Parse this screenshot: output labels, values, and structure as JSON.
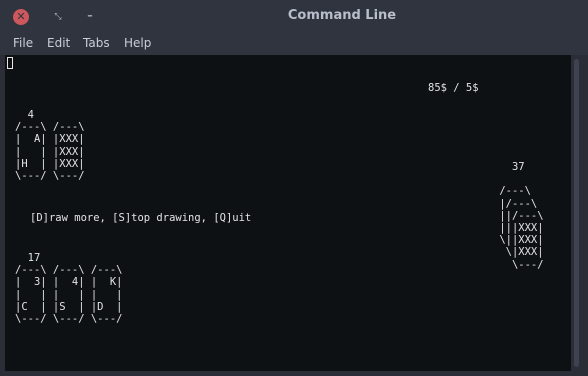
{
  "window": {
    "title": "Command Line",
    "close_glyph": "✕",
    "maximize_glyph": "⤡",
    "minimize_glyph": "–"
  },
  "menu": [
    "File",
    "Edit",
    "Tabs",
    "Help"
  ],
  "terminal": {
    "score": "85$ / 5$",
    "dealer_card_block": "  4\n/---\\ /---\\\n|  A| |XXX|\n|   | |XXX|\n|H  | |XXX|\n\\---/ \\---/",
    "deck_block": "   37\n\n /---\\\n |/---\\\n ||/---\\\n |||XXX|\n \\||XXX|\n  \\|XXX|\n   \\---/",
    "prompt": "[D]raw more, [S]top drawing, [Q]uit",
    "player_card_block": "  17\n/---\\ /---\\ /---\\\n|  3| |  4| |  K|\n|   | |   | |   |\n|C  | |S  | |D  |\n\\---/ \\---/ \\---/"
  },
  "colors": {
    "terminal_bg": "#0e1114",
    "terminal_fg": "#e3e3e3",
    "titlebar_bg": "#2f343f",
    "close_button": "#cc575d"
  }
}
